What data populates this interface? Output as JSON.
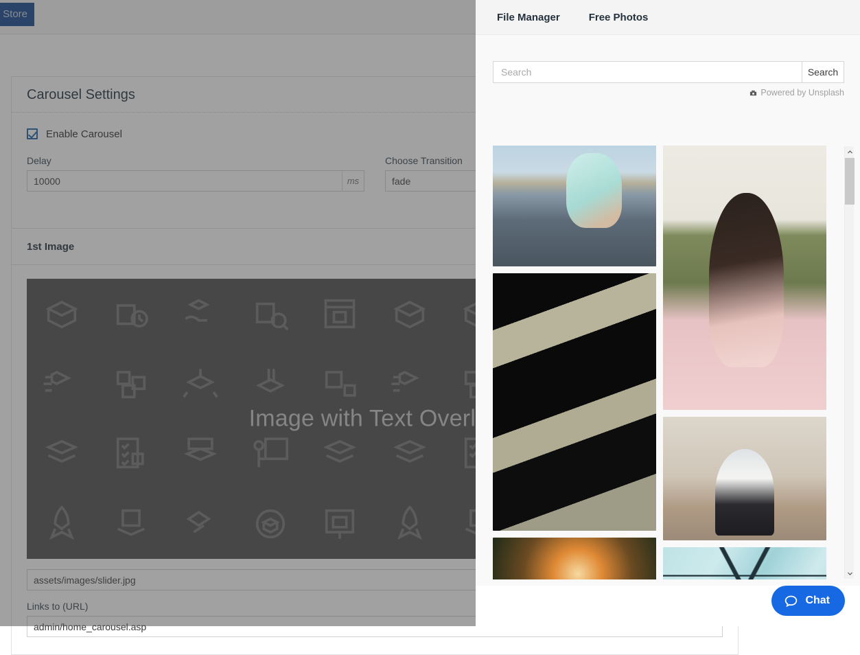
{
  "admin": {
    "view_store_button": "View Store",
    "carousel_panel": {
      "title": "Carousel Settings",
      "enable_label": "Enable Carousel",
      "delay_label": "Delay",
      "delay_value": "10000",
      "delay_unit": "ms",
      "transition_label": "Choose Transition",
      "transition_value": "fade"
    },
    "first_image_panel": {
      "title": "1st Image",
      "placeholder_overlay_text": "Image with Text Overlay",
      "image_path_value": "assets/images/slider.jpg",
      "links_to_label": "Links to (URL)",
      "links_to_value": "admin/home_carousel.asp"
    }
  },
  "modal": {
    "tabs": [
      {
        "label": "File Manager",
        "active": true
      },
      {
        "label": "Free Photos",
        "active": false
      }
    ],
    "search": {
      "placeholder": "Search",
      "value": "",
      "button_label": "Search"
    },
    "attribution": "Powered by Unsplash",
    "attribution_icon": "camera-icon",
    "scrollbar": {
      "up_icon": "chevron-up-icon",
      "down_icon": "chevron-down-icon"
    },
    "photos": {
      "column_left": [
        {
          "name": "photo-beach-feet-water",
          "art": "ph-beach"
        },
        {
          "name": "photo-black-white-stairs",
          "art": "ph-stairs"
        },
        {
          "name": "photo-autumn-forest-sunlight",
          "art": "ph-forest"
        }
      ],
      "column_right": [
        {
          "name": "photo-woman-pink-dress-field",
          "art": "ph-woman"
        },
        {
          "name": "photo-wedding-couple-umbrella",
          "art": "ph-wedding"
        },
        {
          "name": "photo-glass-skylight-ceiling",
          "art": "ph-skylight"
        }
      ]
    }
  },
  "chat": {
    "label": "Chat",
    "icon": "chat-bubble-icon",
    "accent_color": "#1668e3"
  }
}
